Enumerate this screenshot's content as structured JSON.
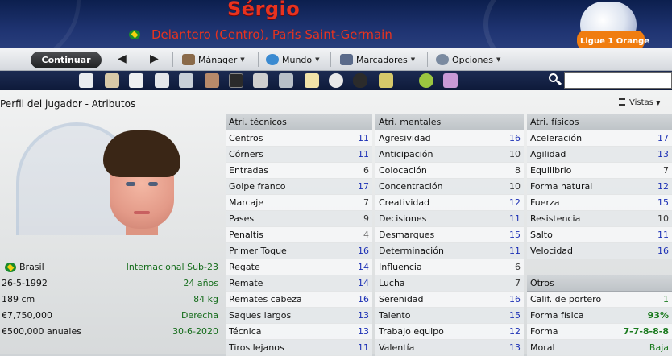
{
  "header": {
    "player_name": "Sérgio",
    "player_role": "Delantero (Centro), Paris Saint-Germain",
    "league_logo_text": "Ligue 1 Orange"
  },
  "navbar": {
    "continue_label": "Continuar",
    "menus": [
      {
        "label": "Mánager",
        "icon": "manager-icon"
      },
      {
        "label": "Mundo",
        "icon": "globe-icon"
      },
      {
        "label": "Marcadores",
        "icon": "scores-icon"
      },
      {
        "label": "Opciones",
        "icon": "gears-icon"
      }
    ]
  },
  "page": {
    "title": "Perfil del jugador - Atributos",
    "views_label": "Vistas"
  },
  "info": [
    {
      "left": "Brasil",
      "right": "Internacional Sub-23"
    },
    {
      "left": "26-5-1992",
      "right": "24 años"
    },
    {
      "left": "189 cm",
      "right": "84 kg"
    },
    {
      "left": "€7,750,000",
      "right": "Derecha"
    },
    {
      "left": "€500,000 anuales",
      "right": "30-6-2020"
    }
  ],
  "tecnicos": {
    "title": "Atri. técnicos",
    "rows": [
      {
        "name": "Centros",
        "value": "11",
        "color": "#1b2fb5"
      },
      {
        "name": "Córners",
        "value": "11",
        "color": "#1b2fb5"
      },
      {
        "name": "Entradas",
        "value": "6",
        "color": "#333333"
      },
      {
        "name": "Golpe franco",
        "value": "17",
        "color": "#1b2fb5"
      },
      {
        "name": "Marcaje",
        "value": "7",
        "color": "#333333"
      },
      {
        "name": "Pases",
        "value": "9",
        "color": "#333333"
      },
      {
        "name": "Penaltis",
        "value": "4",
        "color": "#777777"
      },
      {
        "name": "Primer Toque",
        "value": "16",
        "color": "#1b2fb5"
      },
      {
        "name": "Regate",
        "value": "14",
        "color": "#1b2fb5"
      },
      {
        "name": "Remate",
        "value": "14",
        "color": "#1b2fb5"
      },
      {
        "name": "Remates cabeza",
        "value": "16",
        "color": "#1b2fb5"
      },
      {
        "name": "Saques largos",
        "value": "13",
        "color": "#1b2fb5"
      },
      {
        "name": "Técnica",
        "value": "13",
        "color": "#1b2fb5"
      },
      {
        "name": "Tiros lejanos",
        "value": "11",
        "color": "#1b2fb5"
      }
    ]
  },
  "mentales": {
    "title": "Atri. mentales",
    "rows": [
      {
        "name": "Agresividad",
        "value": "16",
        "color": "#1b2fb5"
      },
      {
        "name": "Anticipación",
        "value": "10",
        "color": "#333333"
      },
      {
        "name": "Colocación",
        "value": "8",
        "color": "#333333"
      },
      {
        "name": "Concentración",
        "value": "10",
        "color": "#333333"
      },
      {
        "name": "Creatividad",
        "value": "12",
        "color": "#1b2fb5"
      },
      {
        "name": "Decisiones",
        "value": "11",
        "color": "#1b2fb5"
      },
      {
        "name": "Desmarques",
        "value": "15",
        "color": "#1b2fb5"
      },
      {
        "name": "Determinación",
        "value": "11",
        "color": "#1b2fb5"
      },
      {
        "name": "Influencia",
        "value": "6",
        "color": "#333333"
      },
      {
        "name": "Lucha",
        "value": "7",
        "color": "#333333"
      },
      {
        "name": "Serenidad",
        "value": "16",
        "color": "#1b2fb5"
      },
      {
        "name": "Talento",
        "value": "15",
        "color": "#1b2fb5"
      },
      {
        "name": "Trabajo equipo",
        "value": "12",
        "color": "#1b2fb5"
      },
      {
        "name": "Valentía",
        "value": "13",
        "color": "#1b2fb5"
      }
    ]
  },
  "fisicos": {
    "title": "Atri. físicos",
    "rows": [
      {
        "name": "Aceleración",
        "value": "17",
        "color": "#1b2fb5"
      },
      {
        "name": "Agilidad",
        "value": "13",
        "color": "#1b2fb5"
      },
      {
        "name": "Equilibrio",
        "value": "7",
        "color": "#333333"
      },
      {
        "name": "Forma natural",
        "value": "12",
        "color": "#1b2fb5"
      },
      {
        "name": "Fuerza",
        "value": "15",
        "color": "#1b2fb5"
      },
      {
        "name": "Resistencia",
        "value": "10",
        "color": "#333333"
      },
      {
        "name": "Salto",
        "value": "11",
        "color": "#1b2fb5"
      },
      {
        "name": "Velocidad",
        "value": "16",
        "color": "#1b2fb5"
      }
    ]
  },
  "otros": {
    "title": "Otros",
    "rows": [
      {
        "name": "Calif. de portero",
        "value": "1",
        "color": "#1a7a1e"
      },
      {
        "name": "Forma física",
        "value": "93%",
        "color": "#1a7a1e"
      },
      {
        "name": "Forma",
        "value": "7-7-8-8-8",
        "color": "#1a7a1e"
      },
      {
        "name": "Moral",
        "value": "Baja",
        "color": "#1a7a1e"
      }
    ]
  }
}
